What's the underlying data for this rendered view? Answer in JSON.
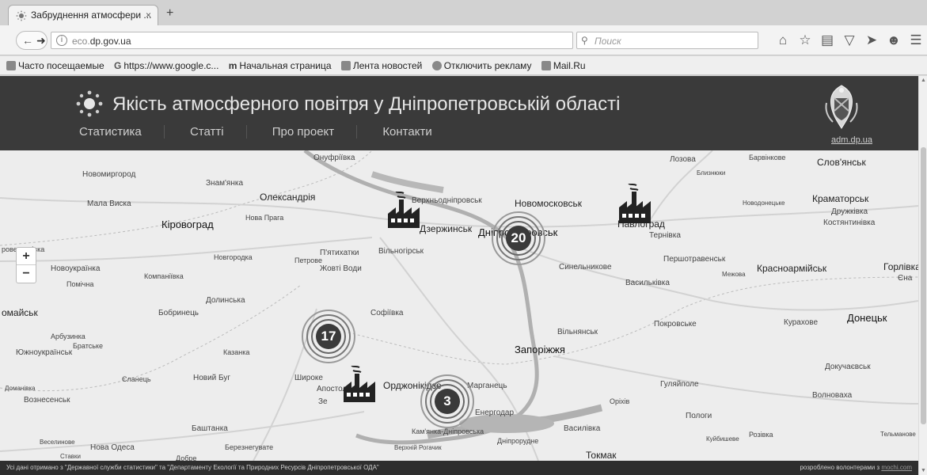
{
  "browser": {
    "tab_title": "Забруднення атмосфери ...",
    "tab_close": "×",
    "new_tab": "+",
    "url_prefix": "eco.",
    "url_domain": "dp.gov.ua",
    "search_placeholder": "Поиск",
    "bookmarks": [
      {
        "label": "Часто посещаемые"
      },
      {
        "label": "https://www.google.c..."
      },
      {
        "label": "Начальная страница"
      },
      {
        "label": "Лента новостей"
      },
      {
        "label": "Отключить рекламу"
      },
      {
        "label": "Mail.Ru"
      }
    ]
  },
  "site": {
    "title": "Якість атмосферного повітря у Дніпропетровській області",
    "nav": [
      "Статистика",
      "Статті",
      "Про проект",
      "Контакти"
    ],
    "crest_link": "adm.dp.ua"
  },
  "map": {
    "zoom_in": "+",
    "zoom_out": "−",
    "clusters": [
      {
        "count": "20"
      },
      {
        "count": "17"
      },
      {
        "count": "3"
      }
    ],
    "cities": {
      "onufriivka": "Онуфріївка",
      "novomyrhorod": "Новомиргород",
      "znamianka": "Знам'янка",
      "oleksandriia": "Олександрія",
      "verkhnodniprovsk": "Верхньодніпровськ",
      "novomoskovsk": "Новомосковськ",
      "lozova": "Лозова",
      "blyzniuky": "Близнюки",
      "barvinkove": "Барвінкове",
      "sloviansk": "Слов'янськ",
      "kramatorsk": "Краматорськ",
      "druzhkivka": "Дружківка",
      "kostiantynivka": "Костянтинівка",
      "novodonetske": "Новодонецьке",
      "mala_vyska": "Мала Виска",
      "kirovohrad": "Кіровоград",
      "nova_praha": "Нова Прага",
      "dzerzhynsk": "Дзержинськ",
      "dnipro": "Дніпропетровськ",
      "ternivka": "Тернівка",
      "pavlohrad": "Павлоград",
      "pershotravensk": "Першотравенськ",
      "krasnoarmiisk": "Красноармійськ",
      "horlivka": "Горлівка",
      "yenakieve": "Єна",
      "novoukrainka": "Новоукраїнка",
      "kompaniivka": "Компаніївка",
      "novhorodka": "Новгородка",
      "petrove": "Петрове",
      "piatykhatky": "П'ятихатки",
      "zhovti_vody": "Жовті Води",
      "vilnohirsk": "Вільногірськ",
      "synelnykove": "Синельникове",
      "mezhova": "Межова",
      "vasylkivka": "Васильківка",
      "pomichna": "Помічна",
      "dolynska": "Долинська",
      "bobrynets": "Бобринець",
      "sofiivka": "Софіївка",
      "kurakhove": "Курахове",
      "donetsk": "Донецьк",
      "pervomaisk": "омайськ",
      "arbuzynka": "Арбузинка",
      "bratske": "Братське",
      "yuzhnoukrainsk": "Южноукраїнськ",
      "kazanka": "Казанка",
      "vilniansk": "Вільнянськ",
      "pokrovske": "Покровське",
      "zaporizhzhia": "Запоріжжя",
      "dokuchaievsk": "Докучаєвськ",
      "yelanets": "Єланець",
      "novyi_buh": "Новий Буг",
      "shyroke": "Широке",
      "apostolove": "Апостолове",
      "ordzhonikidze": "Орджонікідзе",
      "marhanets": "Марганець",
      "huliaipole": "Гуляйполе",
      "domanivka": "Доманівка",
      "voznesensk": "Вознесенськ",
      "orikhiv": "Оріхів",
      "volnovakha": "Волноваха",
      "enerhodar": "Енергодар",
      "kamianka": "Кам'янка-Дніпровська",
      "vasylivka": "Василівка",
      "dniprorudne": "Дніпрорудне",
      "polohy": "Пологи",
      "bashtanka": "Баштанка",
      "veselynove": "Веселинове",
      "nova_odesa": "Нова Одеса",
      "bereznehuvate": "Березнегувате",
      "verkhnii_rohachyk": "Верхній Рогачик",
      "tokmak": "Токмак",
      "kuibysheve": "Куйбишеве",
      "rozivka": "Розівка",
      "telmanove": "Тельманове",
      "stavky": "Ставки",
      "dobre": "Добре",
      "zelenodolsk": "Зе",
      "pervomaisk_tail": "ровеличківка"
    }
  },
  "footer": {
    "left": "Усі дані отримано з \"Державної служби статистики\" та \"Департаменту Екології та Природних Ресурсів Дніпропетровської ОДА\"",
    "right_text": "розроблено волонтерами з ",
    "right_link": "mochi.com"
  },
  "colors": {
    "header_bg": "#3a3a3a",
    "cluster_fill": "#3a3a3a",
    "map_bg": "#ededed"
  }
}
